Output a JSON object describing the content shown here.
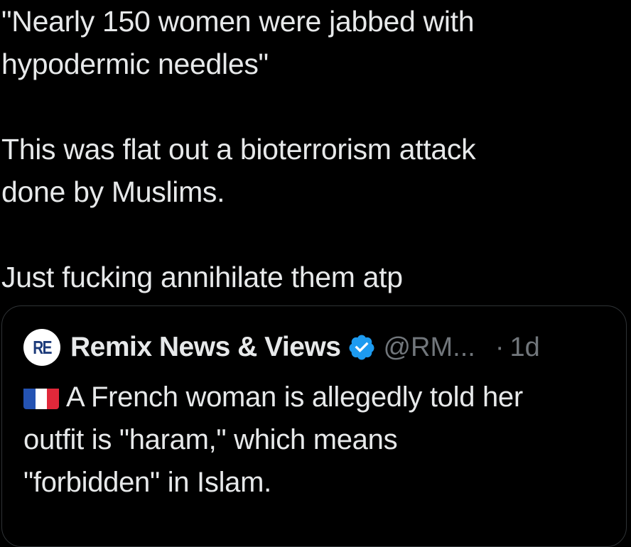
{
  "tweet": {
    "paragraphs": [
      [
        "\"Nearly 150 women were jabbed with",
        "hypodermic needles\""
      ],
      [
        "This was flat out a bioterrorism attack",
        "done by Muslims."
      ],
      [
        "Just fucking annihilate them atp"
      ]
    ]
  },
  "quote": {
    "avatar_text": "RE",
    "author_name": "Remix News & Views",
    "handle": "@RM...",
    "separator": "·",
    "time": "1d",
    "flag_icon": "france-flag-icon",
    "lines": [
      "A French woman is allegedly told her",
      "outfit is \"haram,\" which means",
      "\"forbidden\" in Islam."
    ]
  },
  "colors": {
    "background": "#000000",
    "text": "#e7e9ea",
    "muted": "#71767b",
    "border": "#2f3336",
    "verified": "#1d9bf0"
  }
}
